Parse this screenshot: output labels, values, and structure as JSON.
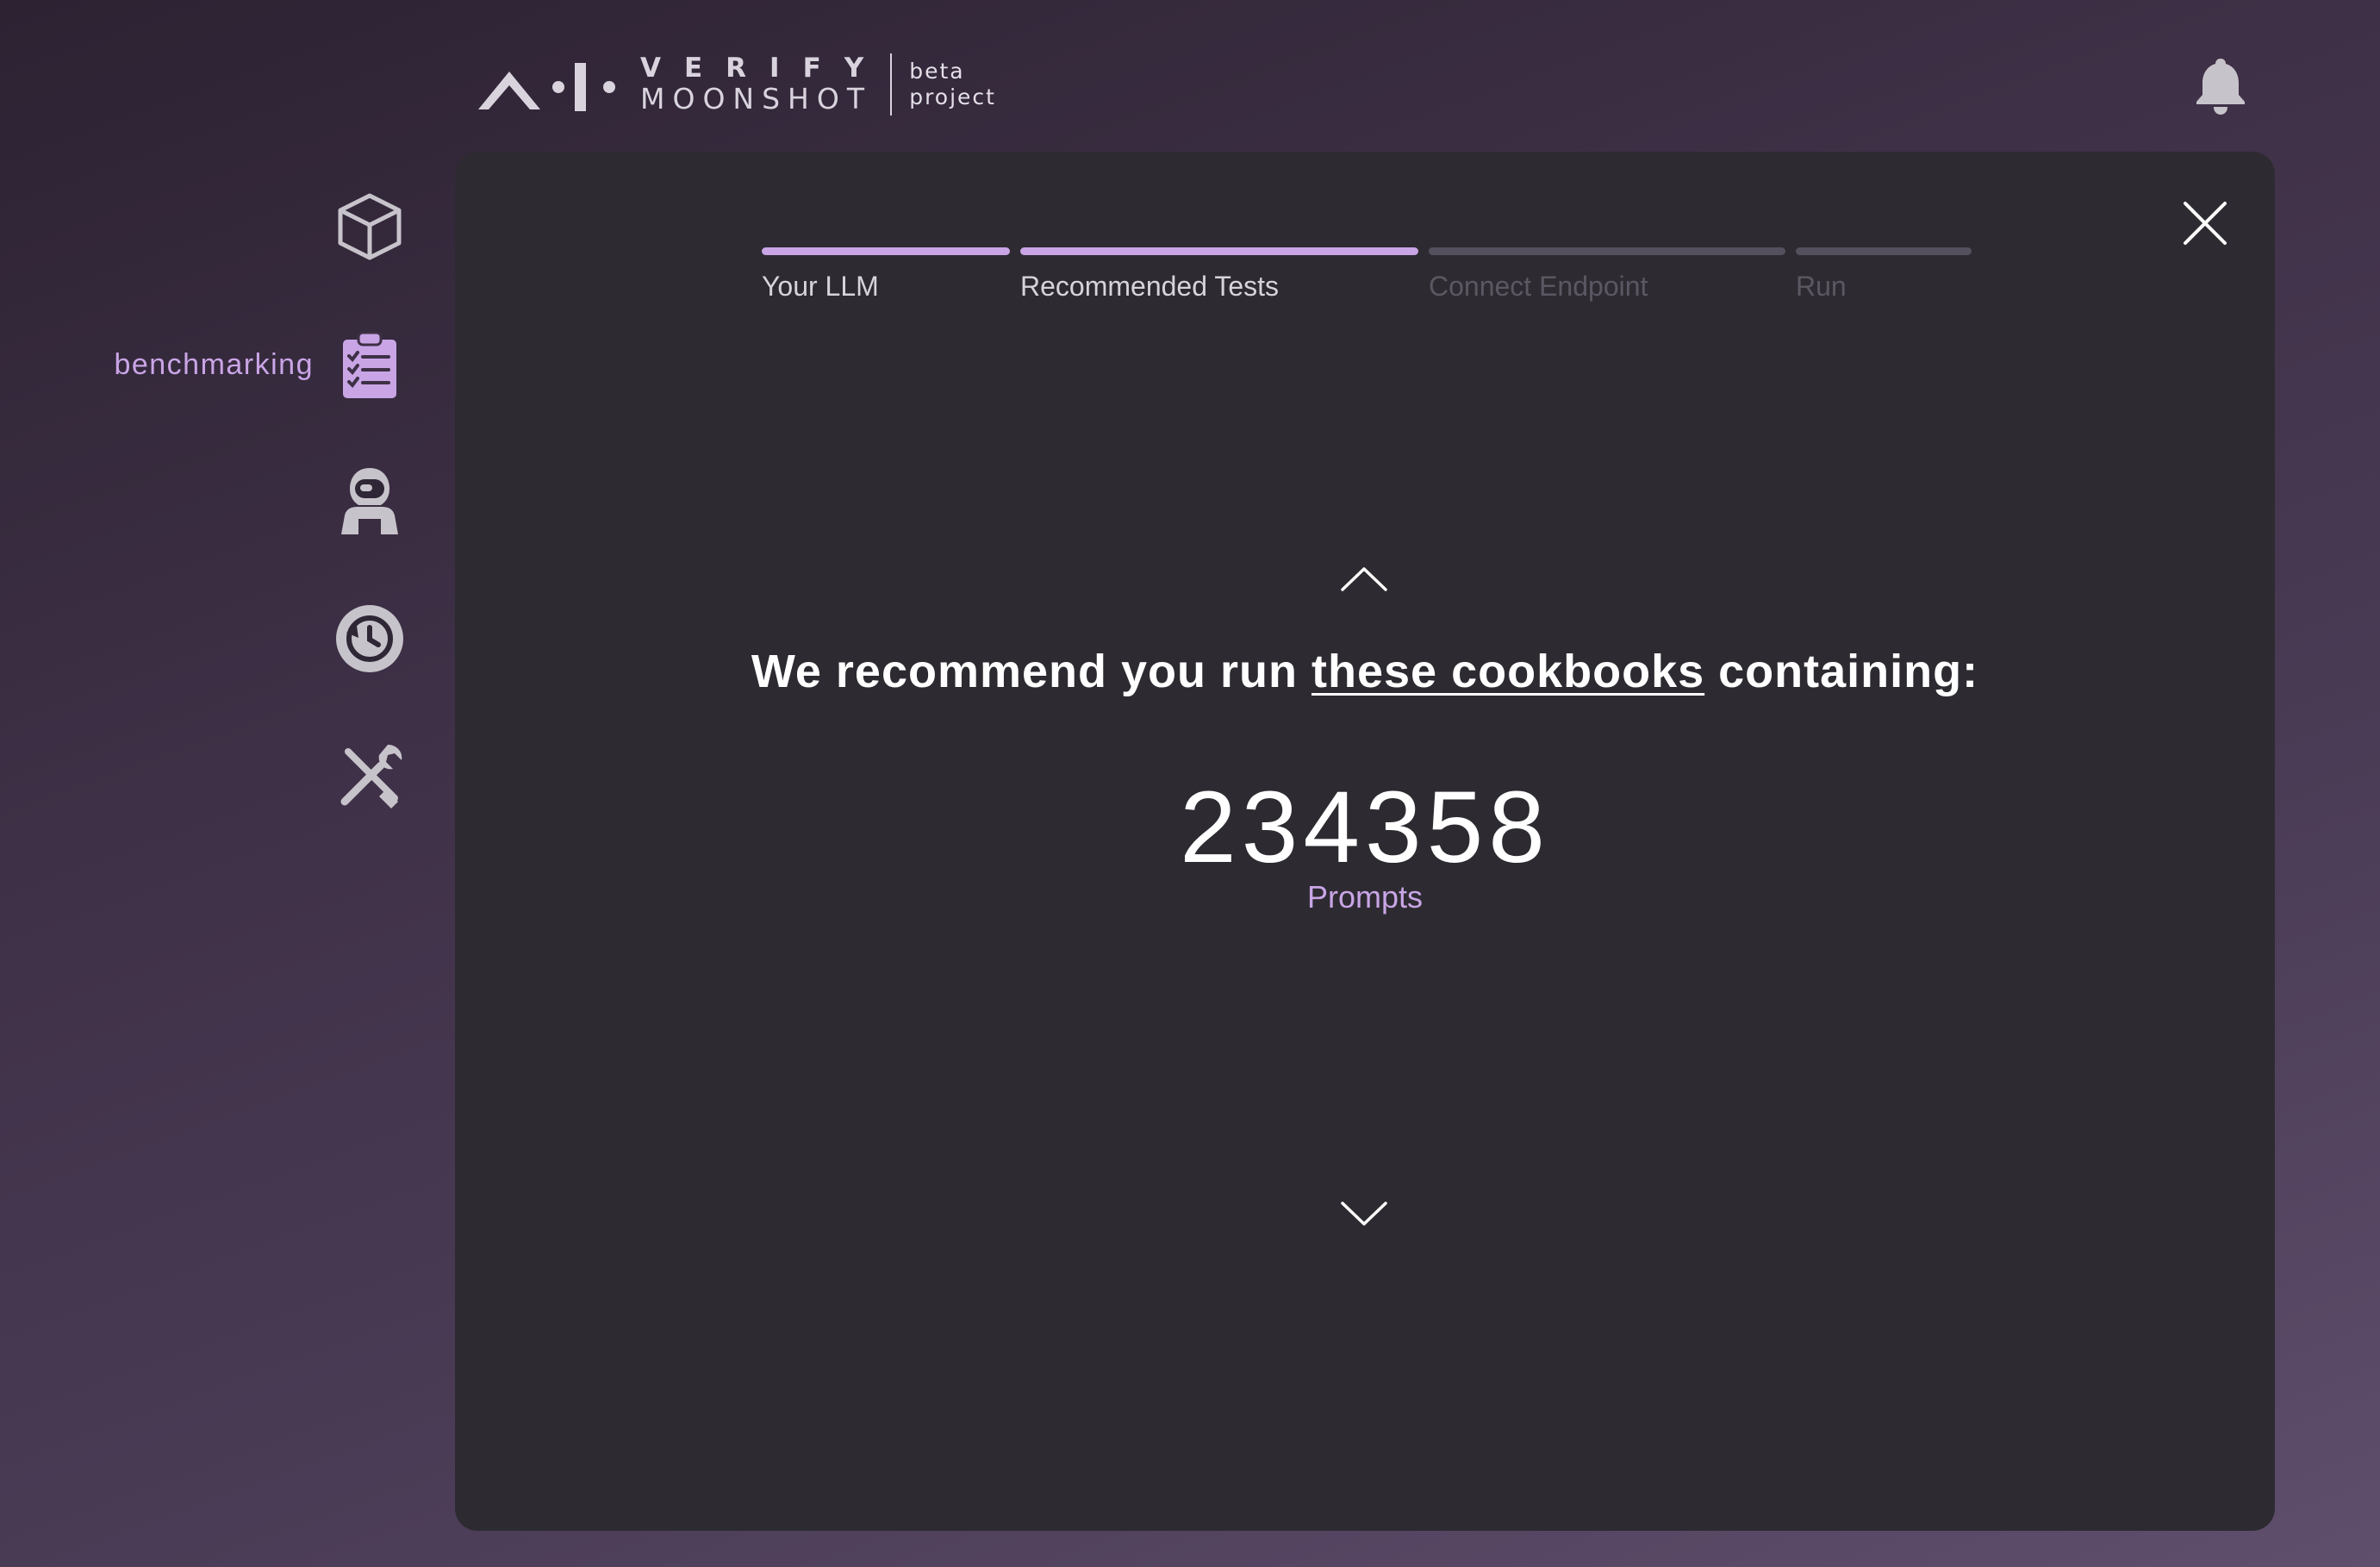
{
  "brand": {
    "line1": "VERIFY",
    "line2": "MOONSHOT",
    "tag_line1": "beta",
    "tag_line2": "project",
    "logo_icon": "ai-verify-logo"
  },
  "header": {
    "notifications_icon": "bell-icon"
  },
  "sidebar": {
    "items": [
      {
        "id": "models",
        "icon": "cube-icon",
        "label": "",
        "active": false
      },
      {
        "id": "benchmarking",
        "icon": "clipboard-checklist-icon",
        "label": "benchmarking",
        "active": true
      },
      {
        "id": "red-teaming",
        "icon": "astronaut-icon",
        "label": "",
        "active": false
      },
      {
        "id": "history",
        "icon": "history-icon",
        "label": "",
        "active": false
      },
      {
        "id": "utilities",
        "icon": "tools-icon",
        "label": "",
        "active": false
      }
    ]
  },
  "stepper": {
    "steps": [
      {
        "label": "Your LLM",
        "completed": true
      },
      {
        "label": "Recommended Tests",
        "completed": true
      },
      {
        "label": "Connect Endpoint",
        "completed": false
      },
      {
        "label": "Run",
        "completed": false
      }
    ]
  },
  "main": {
    "headline_prefix": "We recommend you run ",
    "headline_link": "these cookbooks",
    "headline_suffix": " containing:",
    "prompt_count": "234358",
    "prompt_unit": "Prompts",
    "prev_icon": "chevron-up-icon",
    "next_icon": "chevron-down-icon",
    "close_icon": "close-icon"
  },
  "colors": {
    "accent": "#c9a5e6",
    "modal_bg": "#2d2b31",
    "icon_inactive": "#c7c3cb",
    "step_inactive": "#55505d"
  }
}
